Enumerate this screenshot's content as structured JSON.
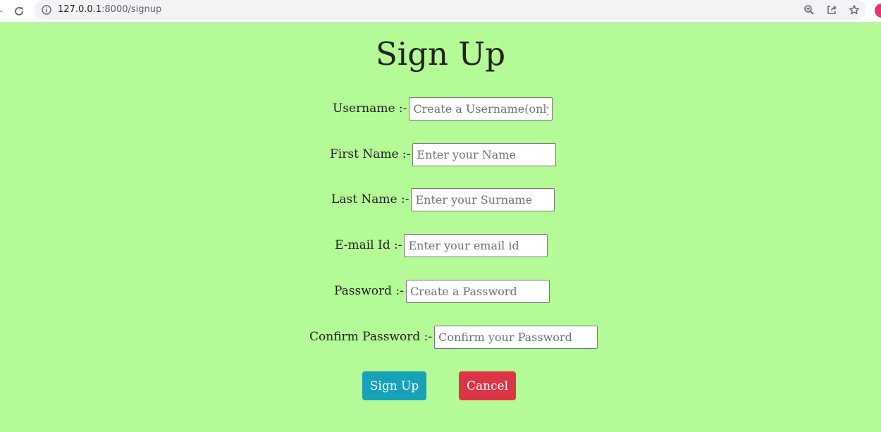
{
  "browser": {
    "url_host": "127.0.0.1",
    "url_rest": ":8000/signup"
  },
  "page": {
    "title": "Sign Up"
  },
  "form": {
    "fields": [
      {
        "label": "Username :-",
        "placeholder": "Create a Username(only letters, numbers and _)",
        "value": ""
      },
      {
        "label": "First Name :-",
        "placeholder": "Enter your Name",
        "value": ""
      },
      {
        "label": "Last Name :-",
        "placeholder": "Enter your Surname",
        "value": ""
      },
      {
        "label": "E-mail Id :-",
        "placeholder": "Enter your email id",
        "value": ""
      },
      {
        "label": "Password :-",
        "placeholder": "Create a Password",
        "value": ""
      },
      {
        "label": "Confirm Password :-",
        "placeholder": "Confirm your Password",
        "value": ""
      }
    ],
    "submit_label": "Sign Up",
    "cancel_label": "Cancel"
  },
  "colors": {
    "page_background": "#b4fa96",
    "submit_button": "#17a2b8",
    "cancel_button": "#dc3545",
    "profile_avatar": "#e8326f"
  },
  "icons": {
    "reload": "reload-icon",
    "info": "info-icon",
    "zoom": "zoom-icon",
    "share": "share-icon",
    "bookmark": "star-icon"
  }
}
